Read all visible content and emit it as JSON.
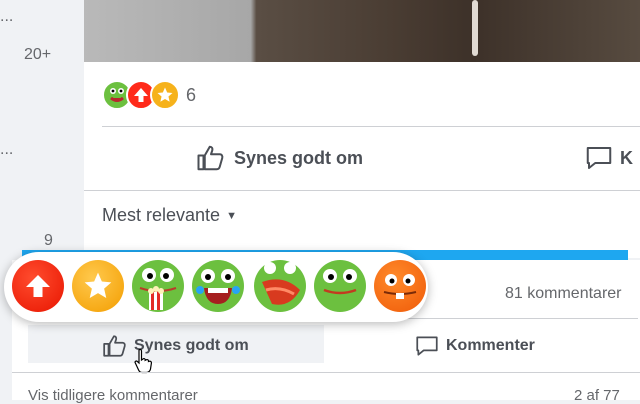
{
  "sidebar": {
    "dots_top": "...",
    "count": "20+",
    "dots_mid": "...",
    "number": "9"
  },
  "post": {
    "reaction_count": "6",
    "like_label": "Synes godt om",
    "comment_label_partial": "K",
    "sort_label": "Mest relevante"
  },
  "reactions_popup": {
    "items": [
      "upvote",
      "star",
      "frog-popcorn",
      "frog-laugh",
      "frog-shout",
      "frog-smile",
      "orange-face"
    ]
  },
  "second_post": {
    "comments_count": "81 kommentarer",
    "like_label": "Synes godt om",
    "comment_label": "Kommenter",
    "view_more": "Vis tidligere kommentarer",
    "page_info": "2 af 77"
  },
  "colors": {
    "accent": "#1ea7f0",
    "red": "#ff2a1a",
    "star": "#f6b21b",
    "green": "#6cc03f",
    "orange": "#ff6f1a"
  }
}
